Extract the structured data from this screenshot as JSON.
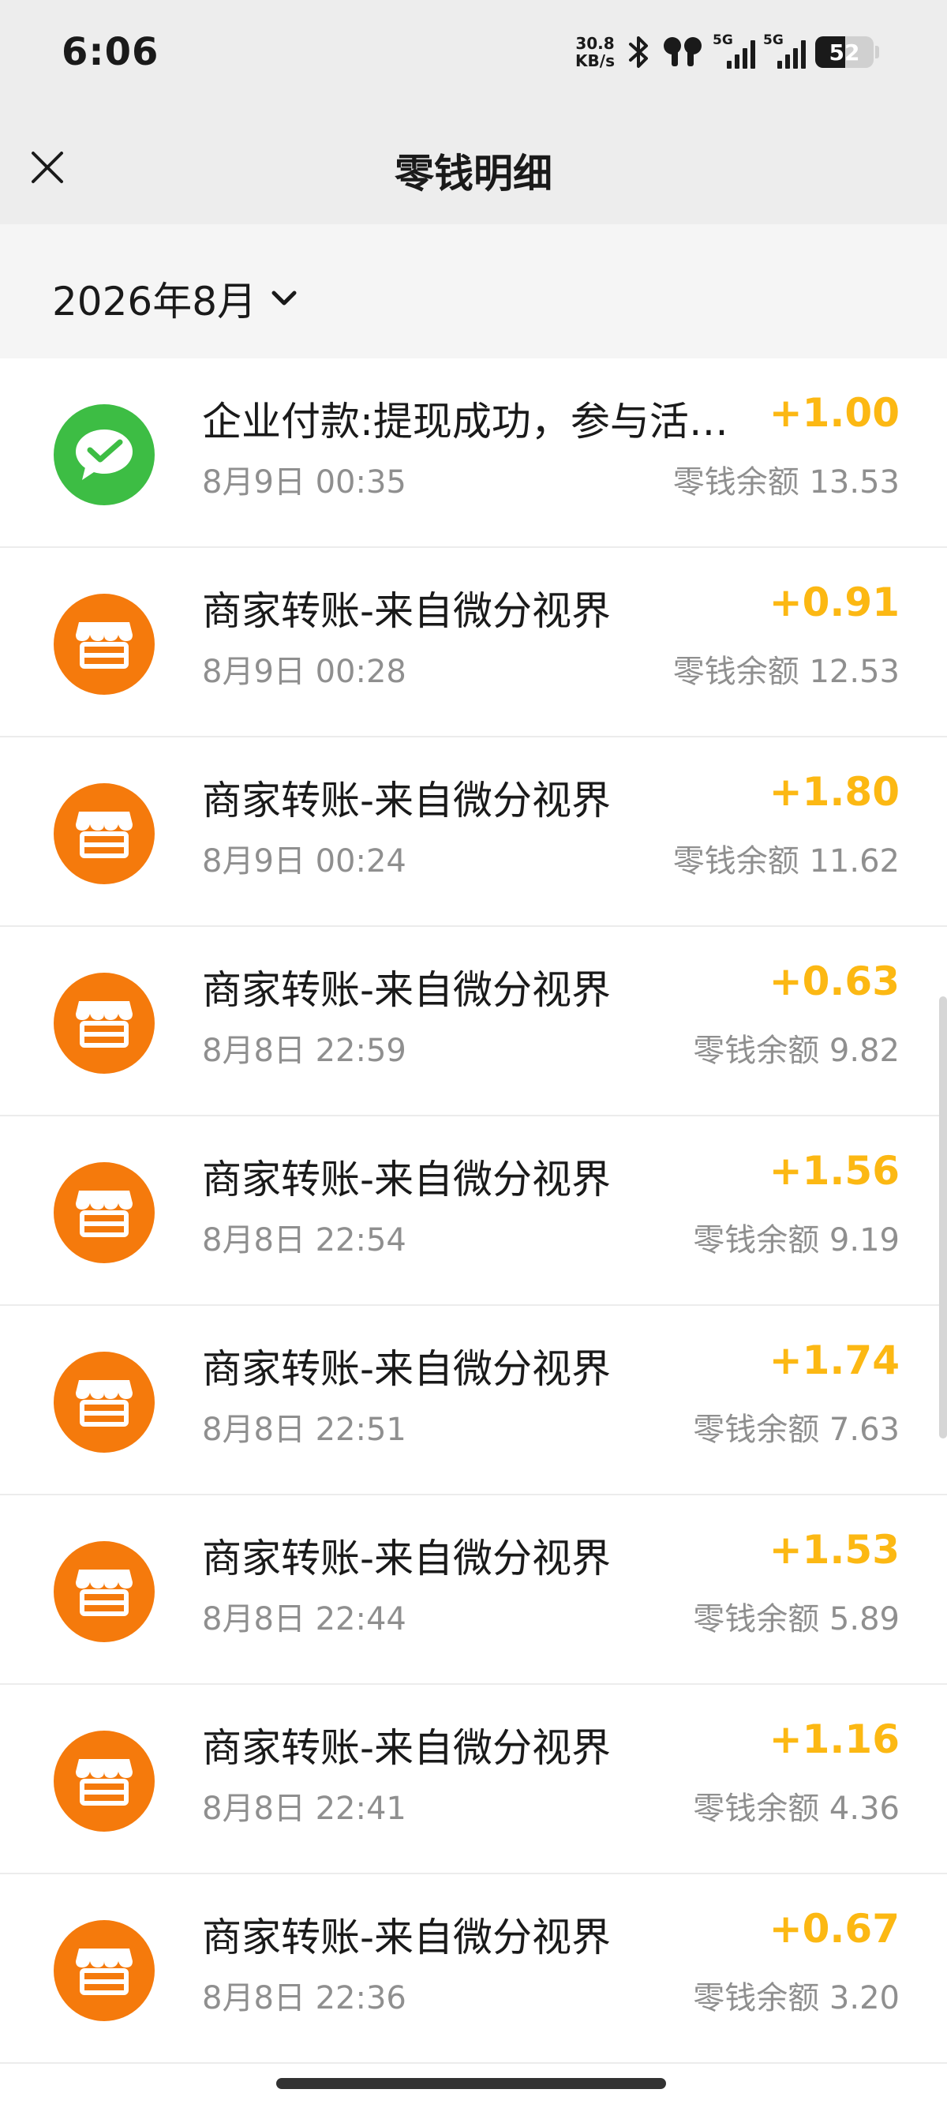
{
  "status_bar": {
    "time": "6:06",
    "net_speed_value": "30.8",
    "net_speed_unit": "KB/s",
    "signal_1_label": "5G",
    "signal_2_label": "5G",
    "battery_level": "52"
  },
  "nav": {
    "title": "零钱明细"
  },
  "filter": {
    "month": "2026年8月"
  },
  "transactions": [
    {
      "icon": "wechat-pay-icon",
      "title": "企业付款:提现成功，参与活…",
      "time": "8月9日 00:35",
      "amount": "+1.00",
      "balance": "零钱余额 13.53"
    },
    {
      "icon": "store-icon",
      "title": "商家转账-来自微分视界",
      "time": "8月9日 00:28",
      "amount": "+0.91",
      "balance": "零钱余额 12.53"
    },
    {
      "icon": "store-icon",
      "title": "商家转账-来自微分视界",
      "time": "8月9日 00:24",
      "amount": "+1.80",
      "balance": "零钱余额 11.62"
    },
    {
      "icon": "store-icon",
      "title": "商家转账-来自微分视界",
      "time": "8月8日 22:59",
      "amount": "+0.63",
      "balance": "零钱余额 9.82"
    },
    {
      "icon": "store-icon",
      "title": "商家转账-来自微分视界",
      "time": "8月8日 22:54",
      "amount": "+1.56",
      "balance": "零钱余额 9.19"
    },
    {
      "icon": "store-icon",
      "title": "商家转账-来自微分视界",
      "time": "8月8日 22:51",
      "amount": "+1.74",
      "balance": "零钱余额 7.63"
    },
    {
      "icon": "store-icon",
      "title": "商家转账-来自微分视界",
      "time": "8月8日 22:44",
      "amount": "+1.53",
      "balance": "零钱余额 5.89"
    },
    {
      "icon": "store-icon",
      "title": "商家转账-来自微分视界",
      "time": "8月8日 22:41",
      "amount": "+1.16",
      "balance": "零钱余额 4.36"
    },
    {
      "icon": "store-icon",
      "title": "商家转账-来自微分视界",
      "time": "8月8日 22:36",
      "amount": "+0.67",
      "balance": "零钱余额 3.20"
    }
  ],
  "colors": {
    "amount": "#fcb813",
    "wechat_green": "#3dbd44",
    "store_orange": "#f57a0c",
    "header_bg": "#ededed",
    "month_bar_bg": "#f5f5f5"
  }
}
